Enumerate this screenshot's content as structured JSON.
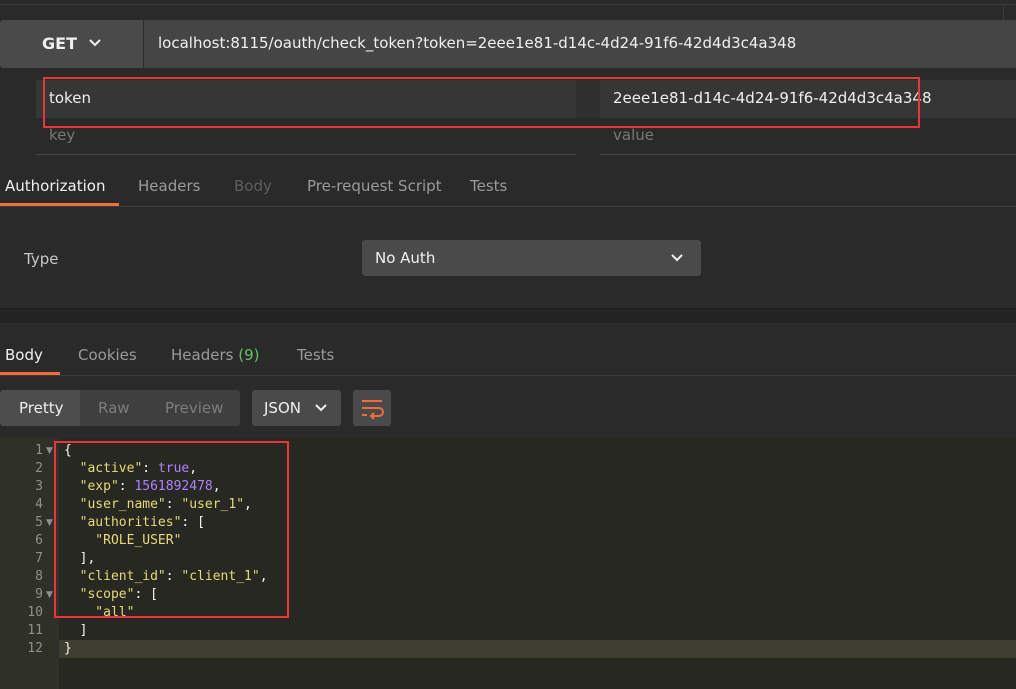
{
  "request": {
    "method": "GET",
    "url": "localhost:8115/oauth/check_token?token=2eee1e81-d14c-4d24-91f6-42d4d3c4a348"
  },
  "params": {
    "rows": [
      {
        "key": "token",
        "value": "2eee1e81-d14c-4d24-91f6-42d4d3c4a348"
      }
    ],
    "placeholder_key": "key",
    "placeholder_value": "value"
  },
  "request_tabs": [
    "Authorization",
    "Headers",
    "Body",
    "Pre-request Script",
    "Tests"
  ],
  "auth": {
    "type_label": "Type",
    "type_value": "No Auth"
  },
  "response_tabs": {
    "body": "Body",
    "cookies": "Cookies",
    "headers": "Headers",
    "headers_count": "(9)",
    "tests": "Tests"
  },
  "response_toolbar": {
    "views": [
      "Pretty",
      "Raw",
      "Preview"
    ],
    "format": "JSON"
  },
  "response_body": {
    "line_numbers": [
      "1",
      "2",
      "3",
      "4",
      "5",
      "6",
      "7",
      "8",
      "9",
      "10",
      "11",
      "12"
    ],
    "lines": [
      "{",
      "  \"active\": true,",
      "  \"exp\": 1561892478,",
      "  \"user_name\": \"user_1\",",
      "  \"authorities\": [",
      "    \"ROLE_USER\"",
      "  ],",
      "  \"client_id\": \"client_1\",",
      "  \"scope\": [",
      "    \"all\"",
      "  ]",
      "}"
    ]
  },
  "colors": {
    "accent": "#f26b3a",
    "highlight_box": "#e8363c",
    "headers_count": "#63c462"
  },
  "icons": {
    "method_dropdown": "chevron-down-icon",
    "auth_dropdown": "chevron-down-icon",
    "format_dropdown": "chevron-down-icon",
    "wrap": "wrap-lines-icon"
  }
}
